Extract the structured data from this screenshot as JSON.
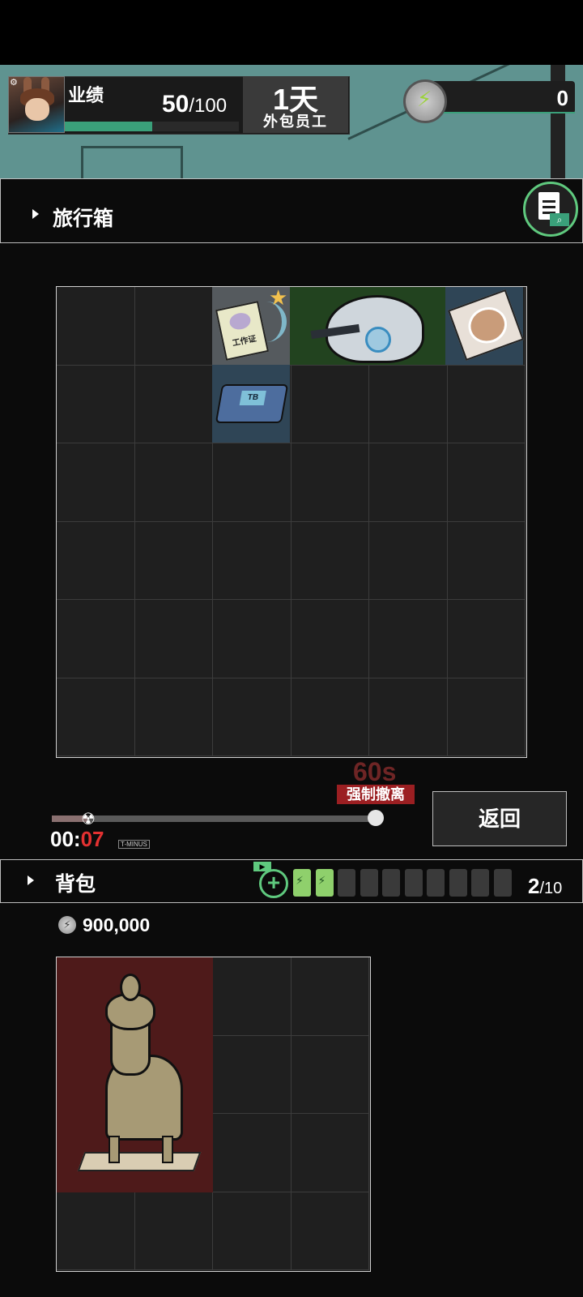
{
  "hud": {
    "performance_label": "业绩",
    "performance_current": "50",
    "performance_max": "/100",
    "performance_progress": 0.5,
    "day_value": "1天",
    "rank_label": "外包员工",
    "coin_value": "0"
  },
  "suitcase": {
    "title": "旅行箱",
    "items": [
      {
        "name": "work-badge-item",
        "label": "工作证",
        "starred": true
      },
      {
        "name": "helmet-item"
      },
      {
        "name": "dessert-plate-item"
      },
      {
        "name": "hard-drive-item",
        "label": "TB"
      }
    ]
  },
  "timer": {
    "countdown_label": "60s",
    "force_evac_label": "强制撤离",
    "clock_prefix": "00:",
    "clock_seconds": "07",
    "tminus_label": "T-MINUS",
    "progress": 0.11
  },
  "return_button": "返回",
  "backpack": {
    "title": "背包",
    "slots_filled": 2,
    "slots_total": 10,
    "count_current": "2",
    "count_max": "/10",
    "money_value": "900,000"
  },
  "colors": {
    "accent_green": "#3aa07a",
    "evac_red": "#9b1f22",
    "clock_red": "#e33131"
  }
}
